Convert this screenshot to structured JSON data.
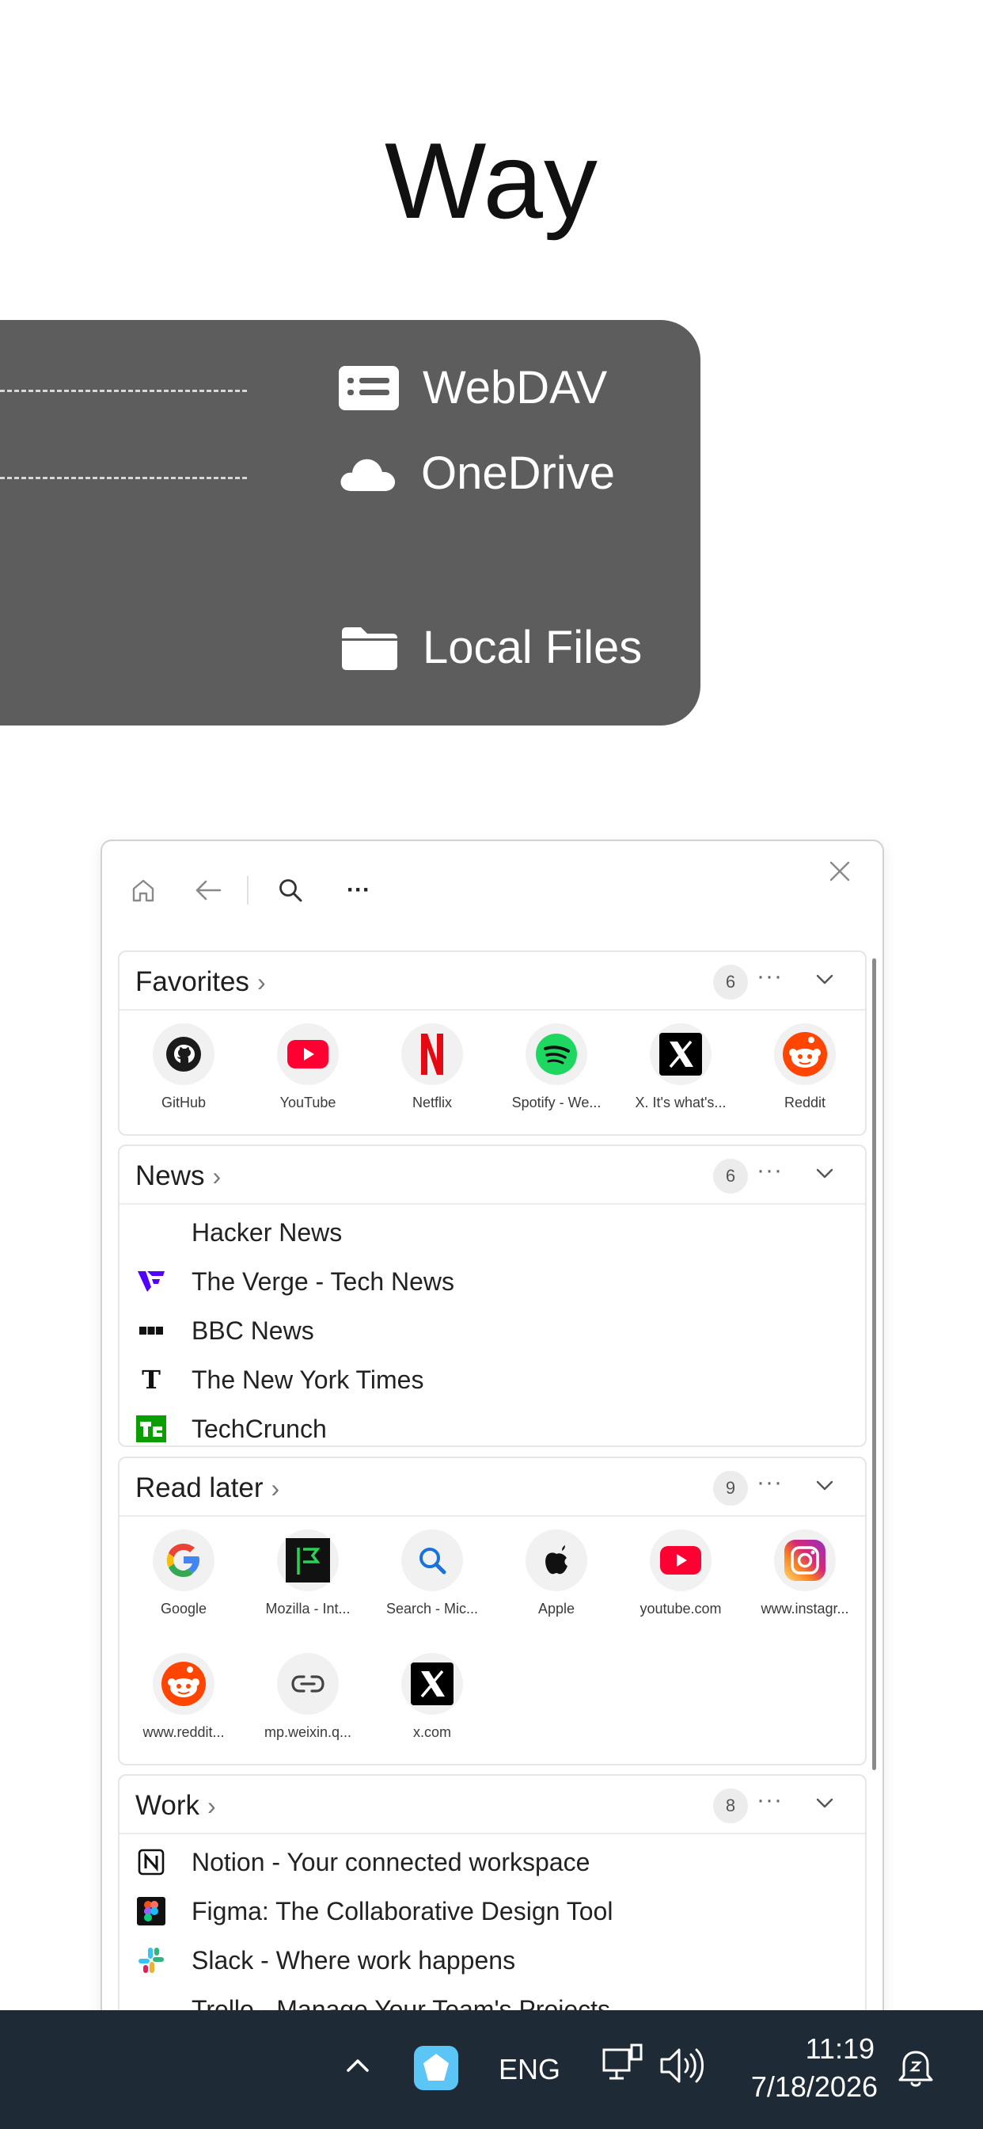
{
  "hero": {
    "title": "Way"
  },
  "storage": {
    "items": [
      {
        "label": "WebDAV",
        "icon": "webdav-icon"
      },
      {
        "label": "OneDrive",
        "icon": "cloud-icon"
      },
      {
        "label": "Local Files",
        "icon": "folder-icon"
      }
    ]
  },
  "window": {
    "toolbar": {
      "home": "home-icon",
      "back": "back-arrow-icon",
      "search": "search-icon",
      "more": "···",
      "close": "close-icon"
    },
    "cards": {
      "favorites": {
        "title": "Favorites",
        "count": "6",
        "items": [
          "GitHub",
          "YouTube",
          "Netflix",
          "Spotify - We...",
          "X. It's what's...",
          "Reddit"
        ]
      },
      "news": {
        "title": "News",
        "count": "6",
        "items": [
          "Hacker News",
          "The Verge - Tech News",
          "BBC News",
          "The New York Times",
          "TechCrunch"
        ]
      },
      "read_later": {
        "title": "Read later",
        "count": "9",
        "items": [
          "Google",
          "Mozilla - Int...",
          "Search - Mic...",
          "Apple",
          "youtube.com",
          "www.instagr...",
          "www.reddit...",
          "mp.weixin.q...",
          "x.com"
        ]
      },
      "work": {
        "title": "Work",
        "count": "8",
        "items": [
          "Notion - Your connected workspace",
          "Figma: The Collaborative Design Tool",
          "Slack - Where work happens",
          "Trello - Manage Your Team's Projects"
        ]
      }
    },
    "more_label": "···"
  },
  "taskbar": {
    "lang": "ENG",
    "time": "11:19",
    "date": "7/18/2026"
  },
  "colors": {
    "panel": "#5d5d5d",
    "taskbar": "#1e2a35",
    "accent": "#5bc6f5"
  }
}
